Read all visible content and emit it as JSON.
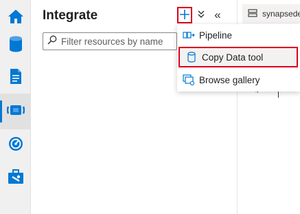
{
  "rail": {
    "items": [
      {
        "name": "home-icon",
        "active": false
      },
      {
        "name": "data-icon",
        "active": false
      },
      {
        "name": "develop-icon",
        "active": false
      },
      {
        "name": "integrate-icon",
        "active": true
      },
      {
        "name": "monitor-icon",
        "active": false
      },
      {
        "name": "manage-icon",
        "active": false
      }
    ]
  },
  "panel": {
    "title": "Integrate",
    "filter_placeholder": "Filter resources by name",
    "add_button_glyph": "+",
    "chevron_glyph": "⌄",
    "collapse_glyph": "«"
  },
  "menu": {
    "items": [
      {
        "label": "Pipeline",
        "icon": "pipeline-icon"
      },
      {
        "label": "Copy Data tool",
        "icon": "copy-data-icon",
        "highlighted": true
      },
      {
        "label": "Browse gallery",
        "icon": "gallery-icon"
      }
    ]
  },
  "tab": {
    "label": "synapsedem",
    "icon": "workspace-icon"
  },
  "editor": {
    "line_number": "4"
  },
  "colors": {
    "accent": "#0078d4",
    "highlight_border": "#d9001b"
  }
}
